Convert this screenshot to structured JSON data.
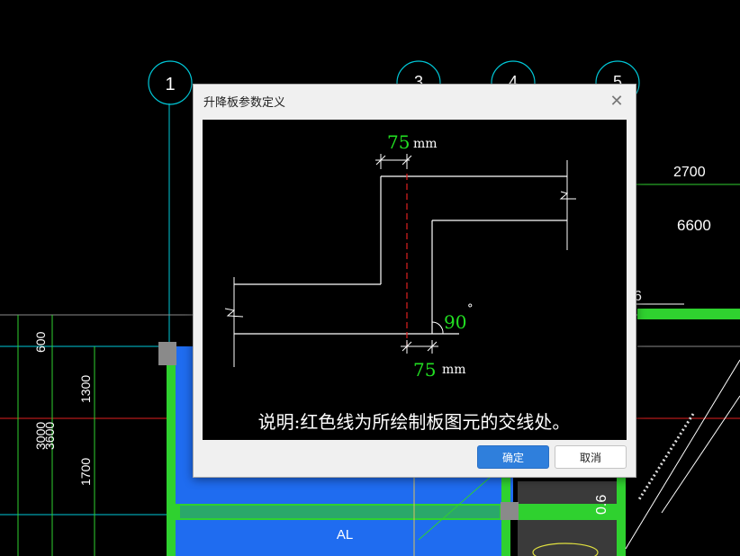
{
  "background": {
    "grid_bubbles": [
      "1",
      "3",
      "4",
      "5"
    ],
    "dims_right": [
      "2700",
      "6600",
      "6"
    ],
    "dims_left": [
      "600",
      "1300",
      "1700",
      "3000",
      "3600"
    ],
    "room_label": "AL",
    "slope_label": "0.6",
    "colors": {
      "beam": "#2fd12f",
      "slab": "#1f6cf0",
      "axis": "#00c8d8",
      "red": "#e02020"
    }
  },
  "dialog": {
    "title": "升降板参数定义",
    "close_icon": "close-icon",
    "diagram": {
      "top_dim_value": "75",
      "top_dim_unit": "mm",
      "angle_value": "90",
      "angle_unit": "°",
      "bottom_dim_value": "75",
      "bottom_dim_unit": "mm",
      "note": "说明:红色线为所绘制板图元的交线处。",
      "colors": {
        "value": "#22e022",
        "line": "#ffffff",
        "red": "#e02020"
      }
    },
    "buttons": {
      "ok": "确定",
      "cancel": "取消"
    }
  }
}
